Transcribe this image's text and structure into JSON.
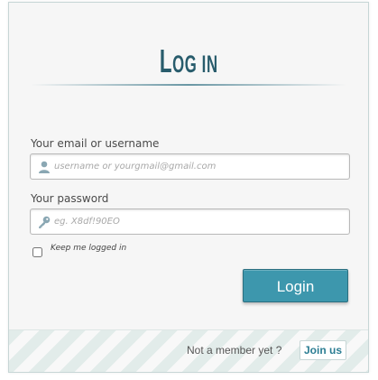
{
  "title": {
    "main": "L",
    "rest": "og in"
  },
  "username": {
    "label": "Your email or username",
    "placeholder": "username or yourgmail@gmail.com",
    "icon": "user-icon"
  },
  "password": {
    "label": "Your password",
    "placeholder": "eg. X8df!90EO",
    "icon": "key-icon"
  },
  "remember": {
    "label": "Keep me logged in",
    "checked": false
  },
  "login_button": {
    "label": "Login"
  },
  "footer": {
    "note": "Not a member yet ?",
    "join_label": "Join us"
  },
  "colors": {
    "title": "#285c6c",
    "button": "#3d97ad",
    "link": "#2b7d93",
    "icon": "#8aa7b3"
  }
}
